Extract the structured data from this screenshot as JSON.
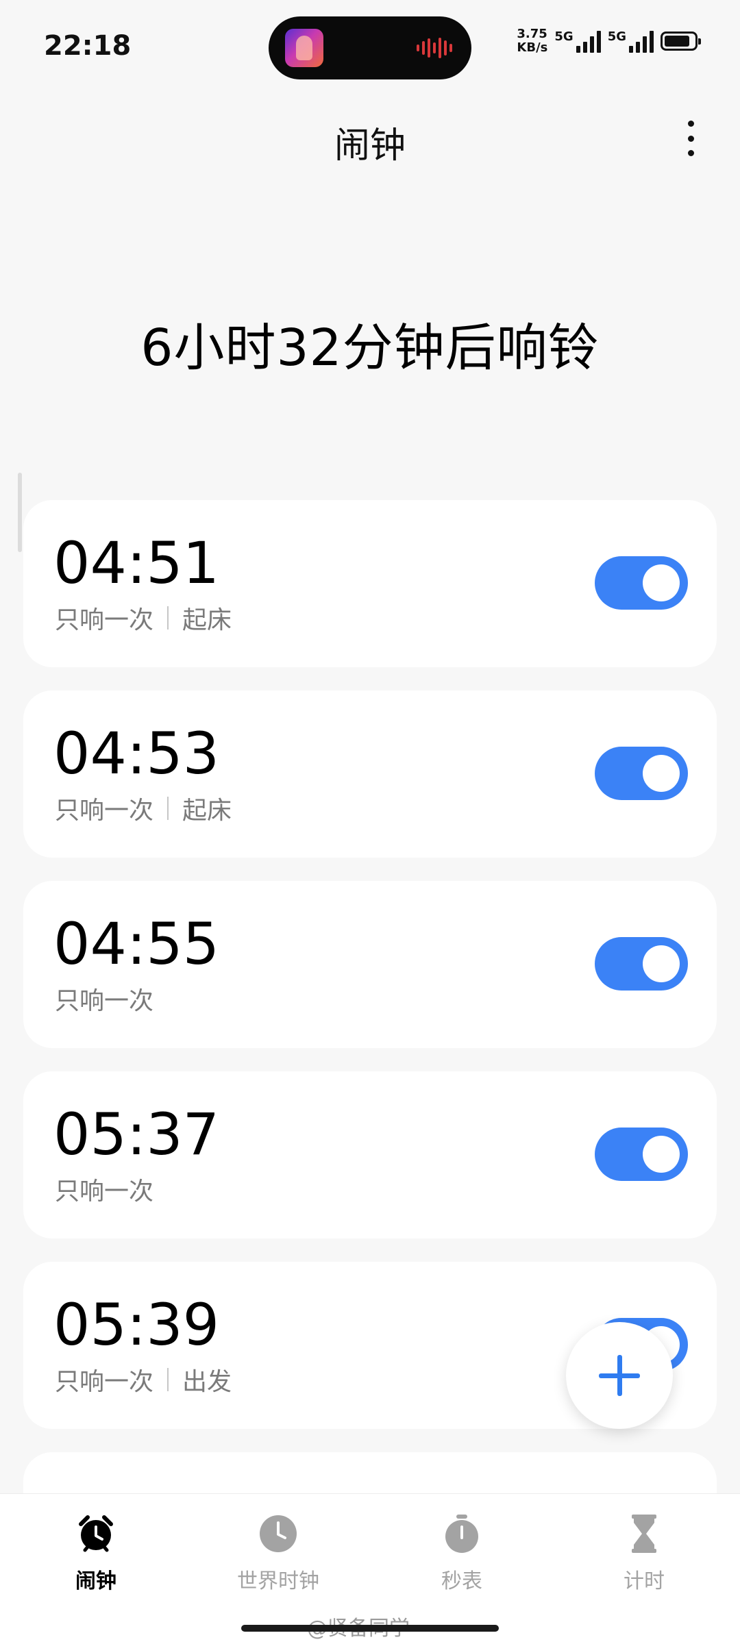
{
  "status_bar": {
    "time": "22:18",
    "net_speed_value": "3.75",
    "net_speed_unit": "KB/s",
    "sim1_label": "5G",
    "sim2_label": "5G"
  },
  "header": {
    "title": "闹钟",
    "more_icon": "more-vertical-icon"
  },
  "next_alarm_text": "6小时32分钟后响铃",
  "alarms": [
    {
      "time": "04:51",
      "repeat": "只响一次",
      "label": "起床",
      "enabled": true
    },
    {
      "time": "04:53",
      "repeat": "只响一次",
      "label": "起床",
      "enabled": true
    },
    {
      "time": "04:55",
      "repeat": "只响一次",
      "label": "",
      "enabled": true
    },
    {
      "time": "05:37",
      "repeat": "只响一次",
      "label": "",
      "enabled": true
    },
    {
      "time": "05:39",
      "repeat": "只响一次",
      "label": "出发",
      "enabled": true
    }
  ],
  "fab_icon": "plus-icon",
  "bottom_nav": [
    {
      "label": "闹钟",
      "icon": "alarm-clock-icon",
      "active": true
    },
    {
      "label": "世界时钟",
      "icon": "clock-icon",
      "active": false
    },
    {
      "label": "秒表",
      "icon": "stopwatch-icon",
      "active": false
    },
    {
      "label": "计时",
      "icon": "hourglass-icon",
      "active": false
    }
  ],
  "watermark": "@贤备同学",
  "colors": {
    "accent": "#3b82f6",
    "background": "#f7f7f7",
    "card": "#ffffff",
    "secondary_text": "#7a7a7a",
    "inactive_nav": "#a3a3a3"
  }
}
